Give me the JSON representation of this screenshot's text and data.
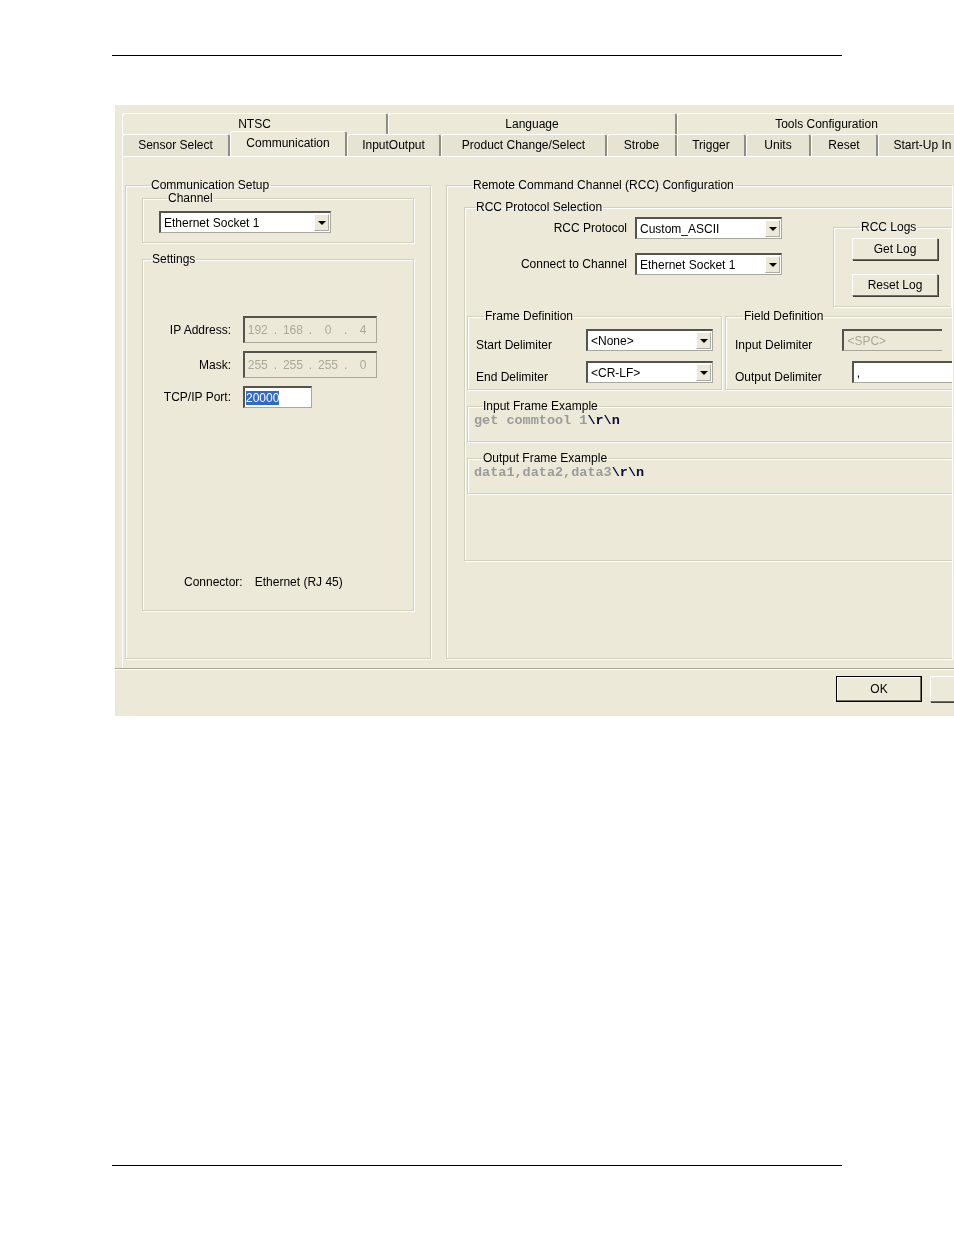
{
  "back_tabs": [
    {
      "label": "NTSC"
    },
    {
      "label": "Language"
    },
    {
      "label": "Tools Configuration"
    }
  ],
  "tabs": [
    {
      "label": "Sensor Select",
      "selected": false
    },
    {
      "label": "Communication",
      "selected": true
    },
    {
      "label": "InputOutput",
      "selected": false
    },
    {
      "label": "Product Change/Select",
      "selected": false
    },
    {
      "label": "Strobe",
      "selected": false
    },
    {
      "label": "Trigger",
      "selected": false
    },
    {
      "label": "Units",
      "selected": false
    },
    {
      "label": "Reset",
      "selected": false
    },
    {
      "label": "Start-Up In",
      "selected": false
    }
  ],
  "communication_setup": {
    "title": "Communication Setup",
    "channel": {
      "title": "Channel",
      "value": "Ethernet Socket 1"
    },
    "settings": {
      "title": "Settings",
      "fields": [
        {
          "kind": "ip",
          "label": "IP Address:",
          "octets": [
            "192",
            "168",
            "0",
            "4"
          ],
          "separator": ".",
          "disabled": true
        },
        {
          "kind": "ip",
          "label": "Mask:",
          "octets": [
            "255",
            "255",
            "255",
            "0"
          ],
          "separator": ".",
          "disabled": true
        },
        {
          "kind": "text",
          "label": "TCP/IP Port:",
          "value": "20000",
          "disabled": false,
          "text_selected": true
        }
      ],
      "connector_label": "Connector:",
      "connector_value": "Ethernet (RJ 45)"
    }
  },
  "rcc": {
    "title": "Remote Command Channel (RCC) Configuration",
    "protocol_selection": {
      "title": "RCC Protocol  Selection",
      "rows": [
        {
          "label": "RCC Protocol",
          "value": "Custom_ASCII"
        },
        {
          "label": "Connect to Channel",
          "value": "Ethernet Socket 1"
        }
      ],
      "logs": {
        "title": "RCC Logs",
        "buttons": [
          "Get Log",
          "Reset Log"
        ]
      }
    },
    "frame_definition": {
      "title": "Frame Definition",
      "rows": [
        {
          "label": "Start Delimiter",
          "value": "<None>",
          "disabled": false
        },
        {
          "label": "End Delimiter",
          "value": "<CR-LF>",
          "disabled": false
        }
      ]
    },
    "field_definition": {
      "title": "Field Definition",
      "rows": [
        {
          "label": "Input Delimiter",
          "value": "<SPC>",
          "disabled": true
        },
        {
          "label": "Output Delimiter",
          "value": ",",
          "disabled": false
        }
      ]
    },
    "examples": [
      {
        "title": "Input Frame Example",
        "text": "get commtool 1",
        "terminator": "\\r\\n"
      },
      {
        "title": "Output Frame Example",
        "text": "data1,data2,data3",
        "terminator": "\\r\\n"
      }
    ]
  },
  "buttons": [
    "OK"
  ]
}
